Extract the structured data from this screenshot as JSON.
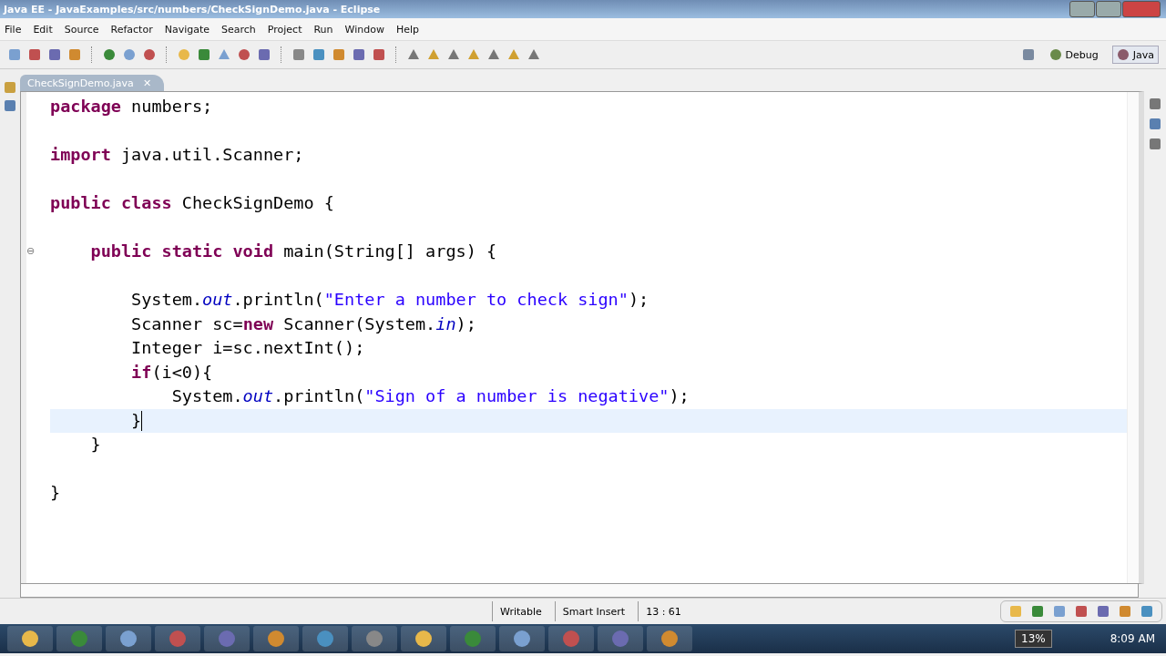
{
  "window": {
    "title": "Java EE - JavaExamples/src/numbers/CheckSignDemo.java - Eclipse"
  },
  "menu": [
    "File",
    "Edit",
    "Source",
    "Refactor",
    "Navigate",
    "Search",
    "Project",
    "Run",
    "Window",
    "Help"
  ],
  "perspectives": [
    {
      "label": "Debug",
      "selected": false
    },
    {
      "label": "Java",
      "selected": true
    }
  ],
  "editor_tab": {
    "label": "CheckSignDemo.java",
    "close": "✕"
  },
  "code": [
    {
      "current": false,
      "tokens": [
        {
          "kind": "kw",
          "text": "package"
        },
        {
          "kind": "plain",
          "text": " numbers;"
        }
      ]
    },
    {
      "current": false
    },
    {
      "current": false,
      "tokens": [
        {
          "kind": "kw",
          "text": "import"
        },
        {
          "kind": "plain",
          "text": " java.util.Scanner;"
        }
      ]
    },
    {
      "current": false
    },
    {
      "current": false,
      "tokens": [
        {
          "kind": "kw",
          "text": "public class"
        },
        {
          "kind": "plain",
          "text": " CheckSignDemo {"
        }
      ],
      "children": [
        {
          "current": false
        },
        {
          "current": false,
          "fold": "⊖",
          "tokens": [
            {
              "kind": "kw",
              "text": "public static void"
            },
            {
              "kind": "plain",
              "text": " main(String[] args) {"
            }
          ],
          "children": [
            {
              "current": false
            },
            {
              "current": false,
              "tokens": [
                {
                  "kind": "plain",
                  "text": "System."
                },
                {
                  "kind": "field",
                  "text": "out"
                },
                {
                  "kind": "plain",
                  "text": ".println("
                },
                {
                  "kind": "str",
                  "text": "\"Enter a number to check sign\""
                },
                {
                  "kind": "plain",
                  "text": ");"
                }
              ]
            },
            {
              "current": false,
              "tokens": [
                {
                  "kind": "plain",
                  "text": "Scanner sc="
                },
                {
                  "kind": "kw",
                  "text": "new"
                },
                {
                  "kind": "plain",
                  "text": " Scanner(System."
                },
                {
                  "kind": "field",
                  "text": "in"
                },
                {
                  "kind": "plain",
                  "text": ");"
                }
              ]
            },
            {
              "current": false,
              "tokens": [
                {
                  "kind": "plain",
                  "text": "Integer i=sc.nextInt();"
                }
              ]
            },
            {
              "current": false,
              "tokens": [
                {
                  "kind": "kw",
                  "text": "if"
                },
                {
                  "kind": "plain",
                  "text": "(i<0){"
                }
              ],
              "children": [
                {
                  "current": false,
                  "tokens": [
                    {
                      "kind": "plain",
                      "text": "System."
                    },
                    {
                      "kind": "field",
                      "text": "out"
                    },
                    {
                      "kind": "plain",
                      "text": ".println("
                    },
                    {
                      "kind": "str",
                      "text": "\"Sign of a number is negative\""
                    },
                    {
                      "kind": "plain",
                      "text": ");"
                    }
                  ]
                }
              ]
            },
            {
              "current": true,
              "tokens": [
                {
                  "kind": "plain",
                  "text": "}"
                }
              ]
            }
          ]
        },
        {
          "current": false,
          "tokens": [
            {
              "kind": "plain",
              "text": "}"
            }
          ]
        },
        {
          "current": false
        }
      ]
    },
    {
      "current": false,
      "tokens": [
        {
          "kind": "plain",
          "text": "}"
        }
      ]
    }
  ],
  "status_bar": {
    "mode": "Writable",
    "insert": "Smart Insert",
    "position": "13 : 61"
  },
  "taskbar": {
    "battery": "13%",
    "time": "8:09 AM"
  }
}
